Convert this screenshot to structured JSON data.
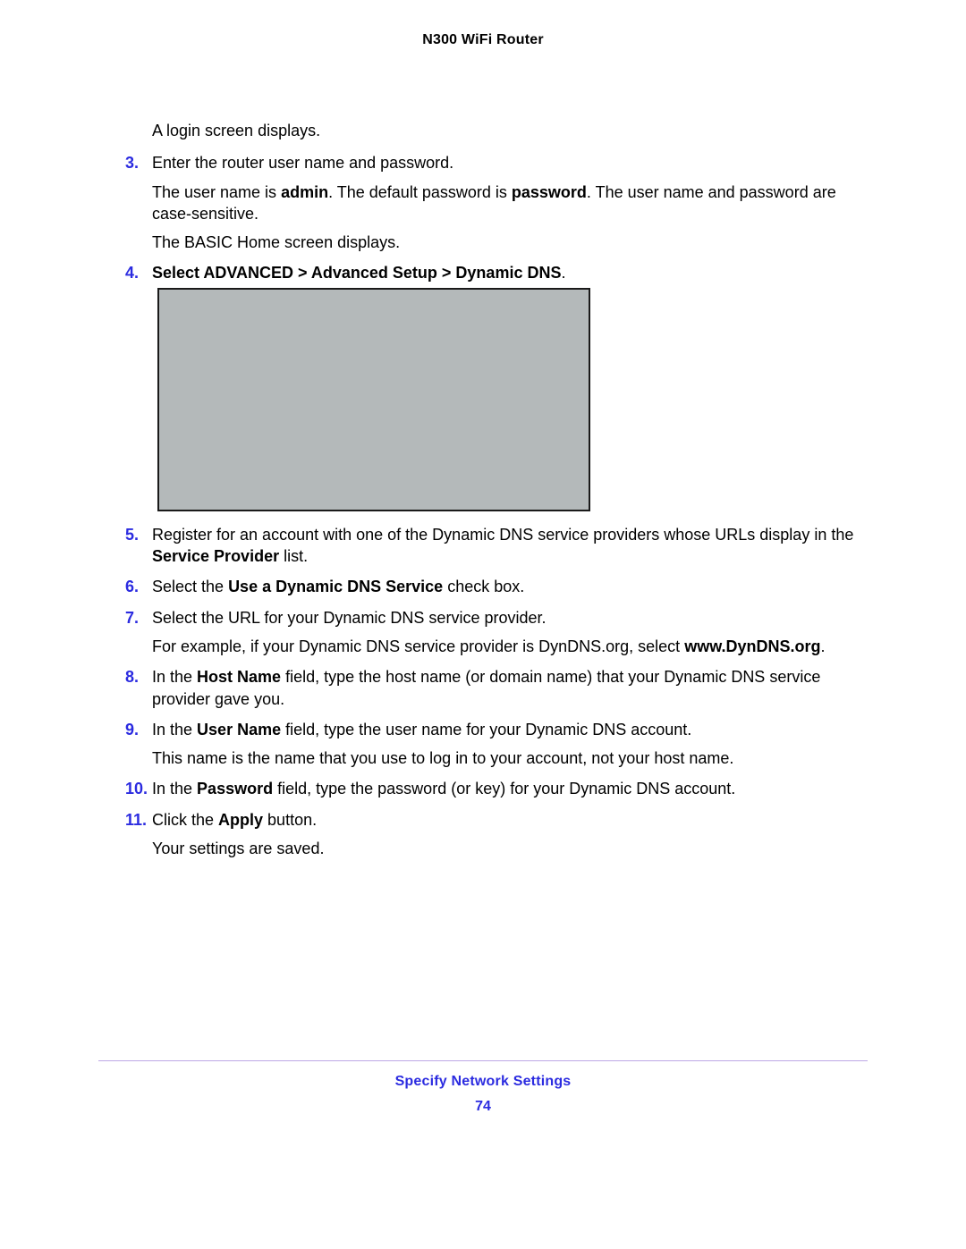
{
  "header": {
    "title": "N300 WiFi Router"
  },
  "intro": "A login screen displays.",
  "steps": {
    "s3": {
      "num": "3.",
      "p1": "Enter the router user name and password.",
      "p2a": "The user name is ",
      "p2b": "admin",
      "p2c": ". The default password is ",
      "p2d": "password",
      "p2e": ". The user name and password are case-sensitive.",
      "p3": "The BASIC Home screen displays."
    },
    "s4": {
      "num": "4.",
      "p1a": "Select ADVANCED > Advanced Setup > Dynamic DNS",
      "p1b": "."
    },
    "s5": {
      "num": "5.",
      "p1a": "Register for an account with one of the Dynamic DNS service providers whose URLs display in the ",
      "p1b": "Service Provider",
      "p1c": " list."
    },
    "s6": {
      "num": "6.",
      "p1a": "Select the ",
      "p1b": "Use a Dynamic DNS Service",
      "p1c": " check box."
    },
    "s7": {
      "num": "7.",
      "p1": "Select the URL for your Dynamic DNS service provider.",
      "p2a": "For example, if your Dynamic DNS service provider is DynDNS.org, select ",
      "p2b": "www.DynDNS.org",
      "p2c": "."
    },
    "s8": {
      "num": "8.",
      "p1a": "In the ",
      "p1b": "Host Name",
      "p1c": " field, type the host name (or domain name) that your Dynamic DNS service provider gave you."
    },
    "s9": {
      "num": "9.",
      "p1a": "In the ",
      "p1b": "User Name",
      "p1c": " field, type the user name for your Dynamic DNS account.",
      "p2": "This name is the name that you use to log in to your account, not your host name."
    },
    "s10": {
      "num": "10.",
      "p1a": "In the ",
      "p1b": "Password",
      "p1c": " field, type the password (or key) for your Dynamic DNS account."
    },
    "s11": {
      "num": "11.",
      "p1a": "Click the ",
      "p1b": "Apply",
      "p1c": " button.",
      "p2": "Your settings are saved."
    }
  },
  "footer": {
    "section": "Specify Network Settings",
    "page": "74"
  }
}
